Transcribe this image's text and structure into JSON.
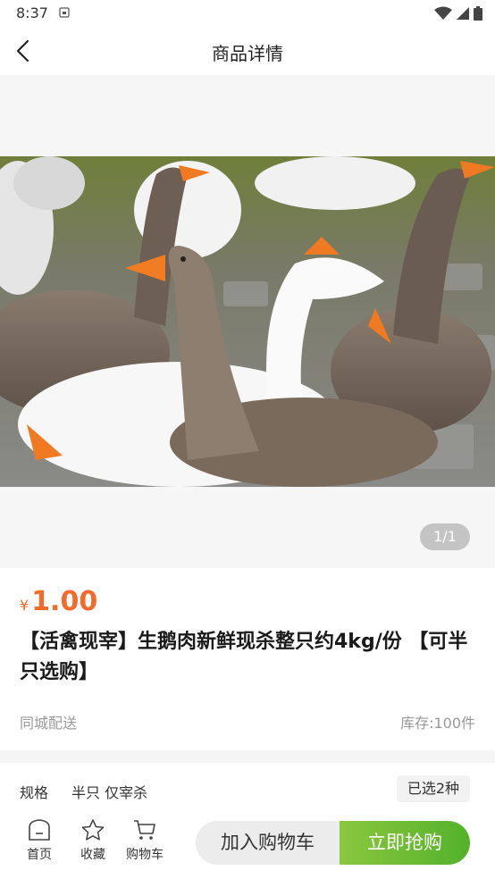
{
  "status_bar": {
    "time": "8:37"
  },
  "header": {
    "title": "商品详情"
  },
  "gallery": {
    "pager": "1/1"
  },
  "product": {
    "price_symbol": "¥",
    "price": "1.00",
    "title": "【活禽现宰】生鹅肉新鲜现杀整只约4kg/份 【可半只选购】",
    "delivery": "同城配送",
    "stock": "库存:100件"
  },
  "spec": {
    "label": "规格",
    "value": "半只  仅宰杀",
    "selected": "已选2种"
  },
  "bottom_bar": {
    "tabs": [
      {
        "label": "首页",
        "icon": "home-icon"
      },
      {
        "label": "收藏",
        "icon": "star-icon"
      },
      {
        "label": "购物车",
        "icon": "cart-icon"
      }
    ],
    "add_to_cart": "加入购物车",
    "buy_now": "立即抢购"
  },
  "colors": {
    "price": "#f46a2a",
    "buy_gradient_start": "#8cc63f",
    "buy_gradient_end": "#52b22a"
  }
}
